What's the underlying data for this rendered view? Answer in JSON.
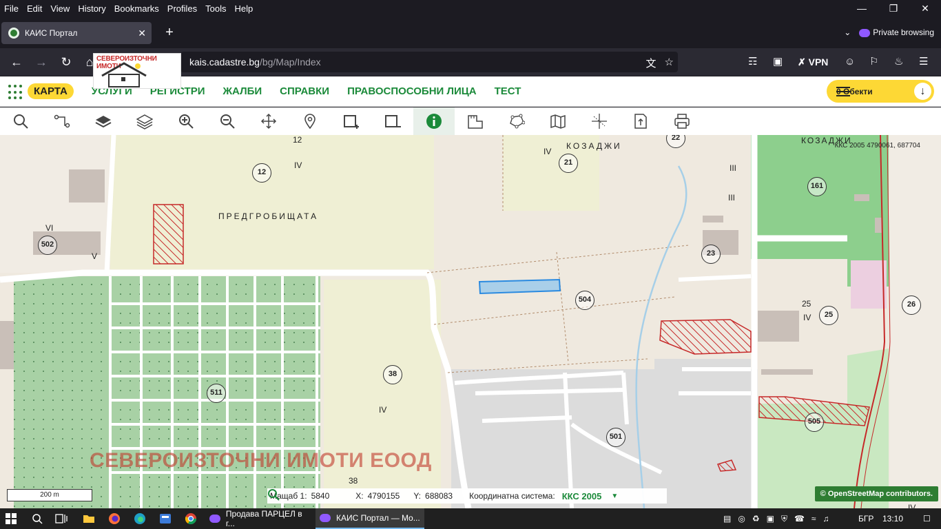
{
  "browser": {
    "menu": [
      "File",
      "Edit",
      "View",
      "History",
      "Bookmarks",
      "Profiles",
      "Tools",
      "Help"
    ],
    "tab_title": "КАИС Портал",
    "private_label": "Private browsing",
    "url_host": "kais.cadastre.bg",
    "url_path": "/bg/Map/Index",
    "vpn_label": "VPN"
  },
  "logo": {
    "text": "СЕВЕРОИЗТОЧНИ ИМОТИ"
  },
  "app": {
    "nav": [
      {
        "label": "КАРТА",
        "active": true
      },
      {
        "label": "УСЛУГИ"
      },
      {
        "label": "РЕГИСТРИ"
      },
      {
        "label": "ЖАЛБИ"
      },
      {
        "label": "СПРАВКИ"
      },
      {
        "label": "ПРАВОСПОСОБНИ ЛИЦА"
      },
      {
        "label": "ТЕСТ"
      }
    ],
    "objects_label": "0 Обекти"
  },
  "map": {
    "kks_readout": "ККС 2005 4790061, 687704",
    "watermark": "СЕВЕРОИЗТОЧНИ ИМОТИ ЕООД",
    "place_labels": [
      "ПРЕДГРОБИЩАТА",
      "КОЗАДЖИ",
      "КОЗАДЖИ"
    ],
    "circled": [
      "12",
      "21",
      "22",
      "502",
      "23",
      "504",
      "161",
      "25",
      "26",
      "38",
      "511",
      "501",
      "505"
    ],
    "roman": [
      "VI",
      "V",
      "IV",
      "IV",
      "III",
      "III",
      "IV",
      "IV",
      "IV"
    ],
    "plain_numbers": [
      "12",
      "25",
      "38"
    ],
    "scale_label": "200 m",
    "status": {
      "scale_label": "Мащаб 1:",
      "scale_value": "5840",
      "x_label": "X:",
      "x_value": "4790155",
      "y_label": "Y:",
      "y_value": "688083",
      "crs_label": "Координатна система:",
      "crs_value": "ККС 2005"
    },
    "attribution": "© OpenStreetMap contributors."
  },
  "taskbar": {
    "apps": [
      "Продава ПАРЦЕЛ в г...",
      "КАИС Портал — Mo..."
    ],
    "lang": "БГР",
    "time": "13:10"
  },
  "colors": {
    "accent_green": "#1b8a3a",
    "accent_yellow": "#fdd835",
    "hatch_red": "#c62828"
  }
}
